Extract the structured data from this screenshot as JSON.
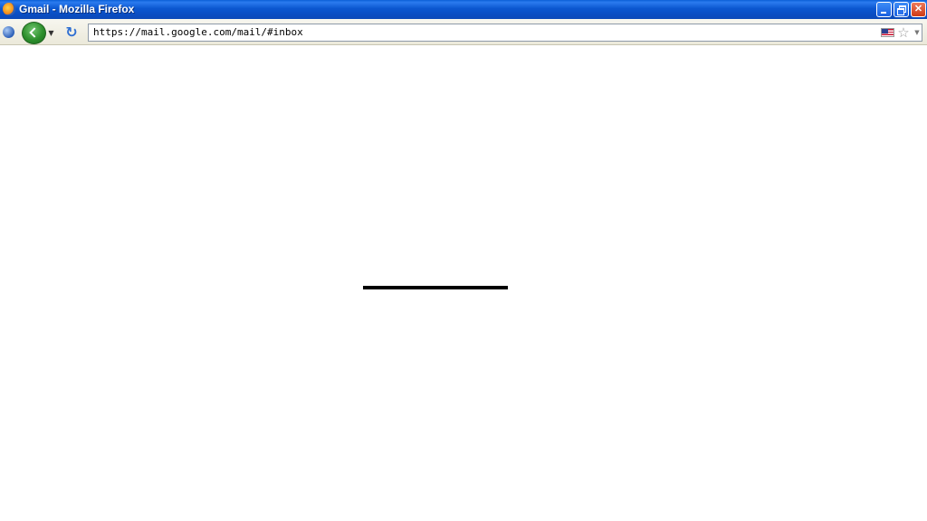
{
  "window": {
    "title": "Gmail - Mozilla Firefox"
  },
  "navbar": {
    "url": "https://mail.google.com/mail/#inbox"
  },
  "icons": {
    "app": "firefox-icon",
    "identity": "site-identity-icon",
    "back": "back-arrow-icon",
    "reload": "reload-icon",
    "flag": "us-flag-icon",
    "bookmark": "star-icon",
    "dropdown": "chevron-down-icon"
  },
  "colors": {
    "titlebar": "#0b57d0",
    "back_button": "#2d8f2c",
    "reload": "#2f6fd2",
    "page_background": "#ffffff",
    "loading_bar": "#000000"
  }
}
